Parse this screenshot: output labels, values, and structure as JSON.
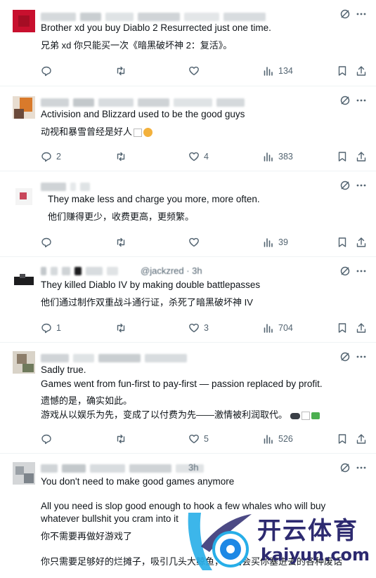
{
  "tweets": [
    {
      "handle_suffix": "",
      "lines": [
        "Brother xd you buy Diablo 2 Resurrected just one time.",
        "兄弟 xd 你只能买一次《暗黑破坏神 2：复活》。"
      ],
      "replies": "",
      "retweets": "",
      "likes": "",
      "views": "134"
    },
    {
      "handle_suffix": "",
      "lines": [
        "Activision and Blizzard used to be the good guys",
        "动视和暴雪曾经是好人"
      ],
      "replies": "2",
      "retweets": "",
      "likes": "4",
      "views": "383"
    },
    {
      "handle_suffix": "",
      "lines": [
        "They make less and charge you more, more often.",
        "他们赚得更少，收费更高，更频繁。"
      ],
      "replies": "",
      "retweets": "",
      "likes": "",
      "views": "39"
    },
    {
      "handle_suffix": "@jackzred · 3h",
      "lines": [
        "They killed Diablo IV by making double battlepasses",
        "他们通过制作双重战斗通行证，杀死了暗黑破坏神 IV"
      ],
      "replies": "1",
      "retweets": "",
      "likes": "3",
      "views": "704"
    },
    {
      "handle_suffix": "",
      "lines": [
        "Sadly true.",
        "Games went from fun-first to pay-first — passion replaced by profit.",
        "遗憾的是，确实如此。",
        "游戏从以娱乐为先，变成了以付费为先——激情被利润取代。"
      ],
      "replies": "",
      "retweets": "",
      "likes": "5",
      "views": "526"
    },
    {
      "handle_suffix": "3h",
      "lines": [
        "You don't need to make good games anymore",
        "All you need is slop good enough to hook a few whales who will buy",
        "whatever bullshit you cram into it",
        "你不需要再做好游戏了",
        "你只需要足够好的烂摊子，吸引几头大鲸鱼，他们会买你塞进去的各种废话"
      ]
    }
  ],
  "icons": {
    "translate": "translate-icon",
    "more": "more-icon",
    "reply": "reply-icon",
    "retweet": "retweet-icon",
    "like": "like-icon",
    "views": "views-icon",
    "bookmark": "bookmark-icon",
    "share": "share-icon",
    "tail_emojis": "controller-money-emoji"
  },
  "watermark": {
    "title": "开云体育",
    "url": "kaiyun.com"
  },
  "colors": {
    "text": "#0f1419",
    "muted": "#536471",
    "divider": "#eff3f4",
    "watermark": "#2d2a70",
    "watermark_accent": "#27aee8"
  }
}
